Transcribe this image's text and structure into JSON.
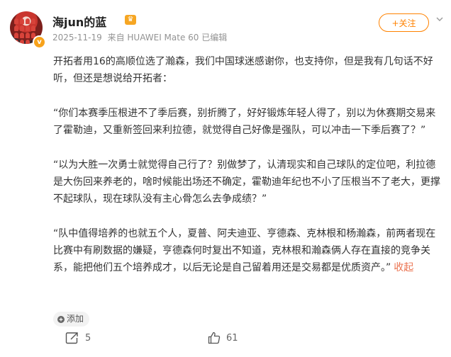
{
  "author": {
    "name": "海jun的蓝",
    "badge_icon": "v-badge-icon",
    "vip_icon": "crown-icon"
  },
  "meta": {
    "date": "2025-11-19",
    "source": "来自 HUAWEI Mate 60",
    "edited": "已编辑"
  },
  "follow_button": "+关注",
  "post": {
    "paragraphs": [
      "开拓者用16的高顺位选了瀚森，我们中国球迷感谢你，也支持你，但是我有几句话不好听，但还是想说给开拓者：",
      "“你们本赛季压根进不了季后赛，别折腾了，好好锻炼年轻人得了，别以为休赛期交易来了霍勒迪，又重新签回来利拉德，就觉得自己好像是强队，可以冲击一下季后赛了？”",
      "“以为大胜一次勇士就觉得自己行了？别做梦了，认清现实和自己球队的定位吧，利拉德是大伤回来养老的，啥时候能出场还不确定，霍勒迪年纪也不小了压根当不了老大，更撑不起球队，现在球队没有主心骨怎么去争成绩？”",
      "“队中值得培养的也就五个人，夏普、阿夫迪亚、亨德森、克林根和杨瀚森，前两者现在比赛中有刷数据的嫌疑，亨德森何时复出不知道，克林根和瀚森俩人存在直接的竞争关系，能把他们五个培养成才，以后无论是自己留着用还是交易都是优质资产。”"
    ],
    "collapse_link": "收起"
  },
  "add_button": "添加",
  "actions": {
    "repost_count": "5",
    "comment_count": "",
    "like_count": "61"
  },
  "colors": {
    "accent_orange": "#ff8200",
    "link": "#eb7350"
  }
}
